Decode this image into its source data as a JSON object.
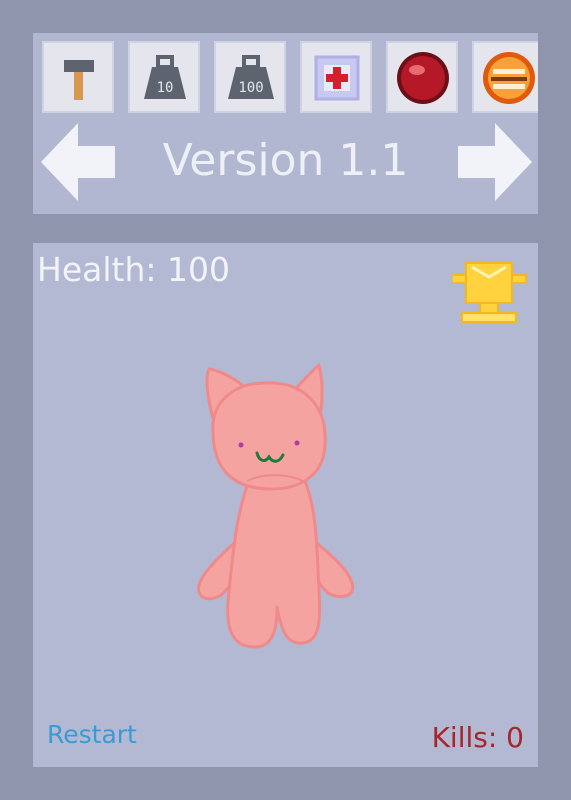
{
  "header": {
    "version_title": "Version 1.1",
    "tools": [
      {
        "name": "hammer",
        "icon": "hammer-icon"
      },
      {
        "name": "weight-10",
        "icon": "weight-10-icon",
        "label": "10"
      },
      {
        "name": "weight-100",
        "icon": "weight-100-icon",
        "label": "100"
      },
      {
        "name": "medkit",
        "icon": "medkit-icon"
      },
      {
        "name": "red-ball",
        "icon": "red-ball-icon"
      },
      {
        "name": "orange-ball",
        "icon": "orange-ball-icon"
      }
    ],
    "prev_icon": "arrow-left-icon",
    "next_icon": "arrow-right-icon"
  },
  "game": {
    "health_label": "Health: 100",
    "kills_label": "Kills: 0",
    "restart_label": "Restart",
    "character": "pink-cat",
    "trophy_icon": "trophy-icon"
  },
  "colors": {
    "background": "#8e95ad",
    "panel": "#b3b8d3",
    "cat_fill": "#f5a3a1",
    "cat_outline": "#f08a8a",
    "restart": "#3a9ad4",
    "kills": "#a5262b",
    "trophy": "#ffd23e"
  }
}
